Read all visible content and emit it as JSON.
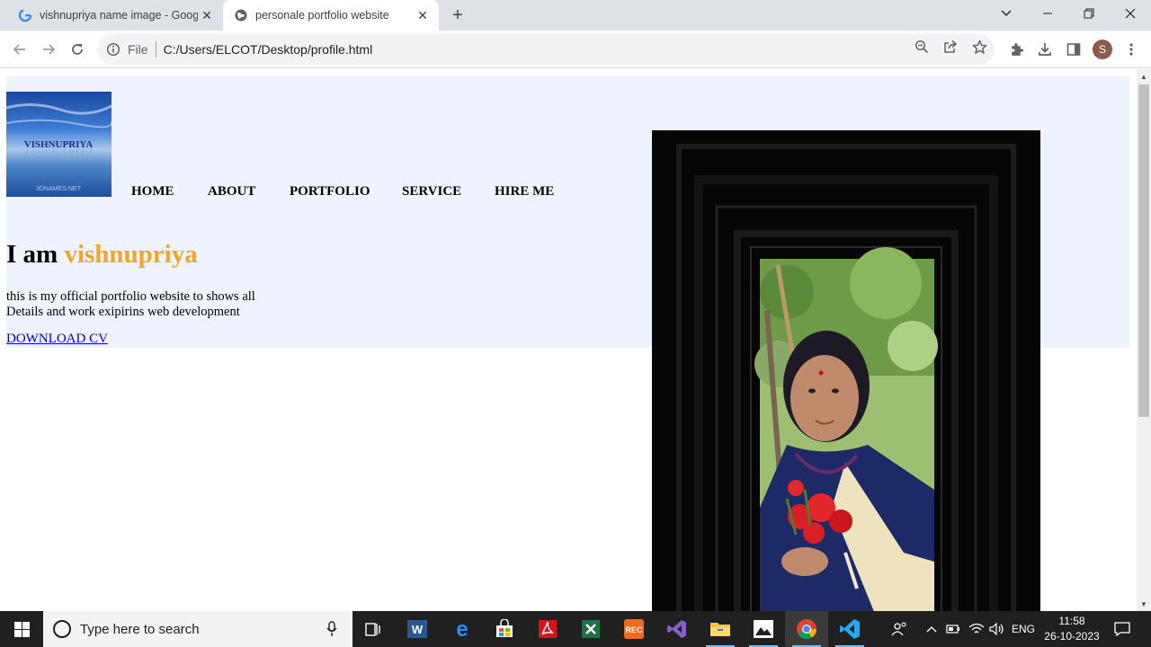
{
  "browser": {
    "tabs": [
      {
        "title": "vishnupriya name image - Goog",
        "favicon": "google-icon",
        "active": false
      },
      {
        "title": "personale portfolio website",
        "favicon": "globe-icon",
        "active": true
      }
    ],
    "address": {
      "scheme_label": "File",
      "url": "C:/Users/ELCOT/Desktop/profile.html"
    },
    "profile_initial": "S"
  },
  "page": {
    "logo_text": "VISHNUPRIYA",
    "logo_watermark": "3DNAMES.NET",
    "nav": [
      "HOME",
      "ABOUT",
      "PORTFOLIO",
      "SERVICE",
      "HIRE ME"
    ],
    "headline": {
      "prefix": "I am",
      "name": "vishnupriya"
    },
    "description": {
      "line1": "this is my official portfolio website to shows all",
      "line2": "Details and work exipirins web development"
    },
    "cta": "DOWNLOAD CV",
    "colors": {
      "hero_bg": "#eef3fe",
      "accent": "#f5a623",
      "link": "#0000ee"
    }
  },
  "taskbar": {
    "search_placeholder": "Type here to search",
    "apps": [
      "task-view-icon",
      "word-icon",
      "edge-icon",
      "store-icon",
      "acrobat-icon",
      "excel-icon",
      "bandicam-icon",
      "visual-studio-icon",
      "file-explorer-icon",
      "photos-icon",
      "chrome-icon",
      "vscode-icon"
    ],
    "language": "ENG",
    "time": "11:58",
    "date": "26-10-2023"
  }
}
